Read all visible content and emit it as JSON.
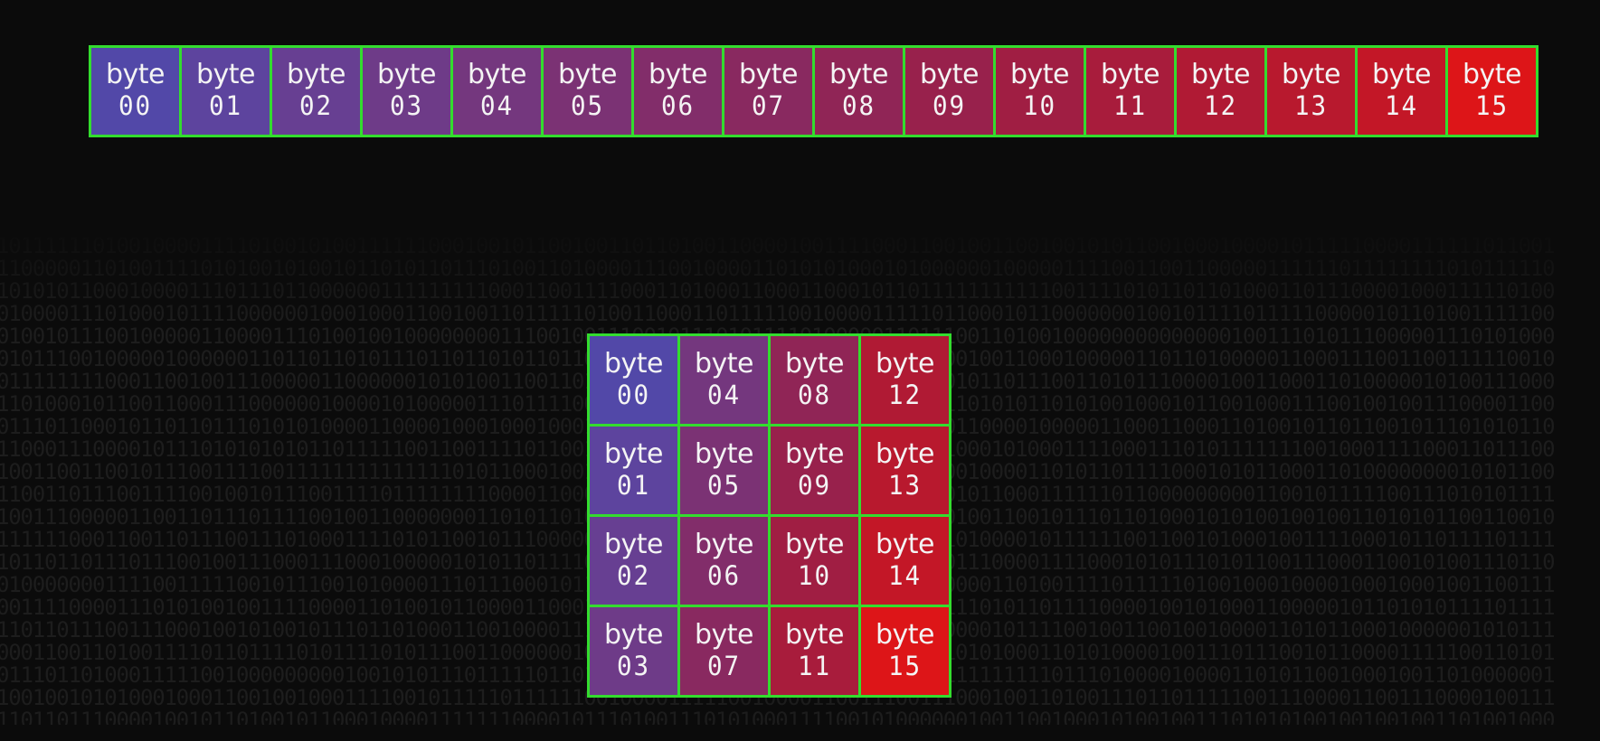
{
  "colors": {
    "background": "#0b0b0b",
    "border": "#33dd2e",
    "text": "#f4f4f4",
    "binary_text": "#1d1d1d",
    "gradient_start": "#5248a8",
    "gradient_end": "#dd1518"
  },
  "cell_word": "byte",
  "strip": {
    "cells": [
      {
        "num": "00",
        "color": "#5248a8"
      },
      {
        "num": "01",
        "color": "#5d449e"
      },
      {
        "num": "02",
        "color": "#673f92"
      },
      {
        "num": "03",
        "color": "#6e3b88"
      },
      {
        "num": "04",
        "color": "#74377e"
      },
      {
        "num": "05",
        "color": "#7b3274"
      },
      {
        "num": "06",
        "color": "#822d6a"
      },
      {
        "num": "07",
        "color": "#892960"
      },
      {
        "num": "08",
        "color": "#902556"
      },
      {
        "num": "09",
        "color": "#98214c"
      },
      {
        "num": "10",
        "color": "#a01e43"
      },
      {
        "num": "11",
        "color": "#a81c3c"
      },
      {
        "num": "12",
        "color": "#b01a34"
      },
      {
        "num": "13",
        "color": "#b8192e"
      },
      {
        "num": "14",
        "color": "#c31727"
      },
      {
        "num": "15",
        "color": "#dd1518"
      }
    ]
  },
  "grid": {
    "rows": [
      [
        {
          "num": "00",
          "color": "#5248a8"
        },
        {
          "num": "04",
          "color": "#74377e"
        },
        {
          "num": "08",
          "color": "#902556"
        },
        {
          "num": "12",
          "color": "#b01a34"
        }
      ],
      [
        {
          "num": "01",
          "color": "#5d449e"
        },
        {
          "num": "05",
          "color": "#7b3274"
        },
        {
          "num": "09",
          "color": "#98214c"
        },
        {
          "num": "13",
          "color": "#b8192e"
        }
      ],
      [
        {
          "num": "02",
          "color": "#673f92"
        },
        {
          "num": "06",
          "color": "#822d6a"
        },
        {
          "num": "10",
          "color": "#a01e43"
        },
        {
          "num": "14",
          "color": "#c31727"
        }
      ],
      [
        {
          "num": "03",
          "color": "#6e3b88"
        },
        {
          "num": "07",
          "color": "#892960"
        },
        {
          "num": "11",
          "color": "#a81c3c"
        },
        {
          "num": "15",
          "color": "#dd1518"
        }
      ]
    ]
  }
}
